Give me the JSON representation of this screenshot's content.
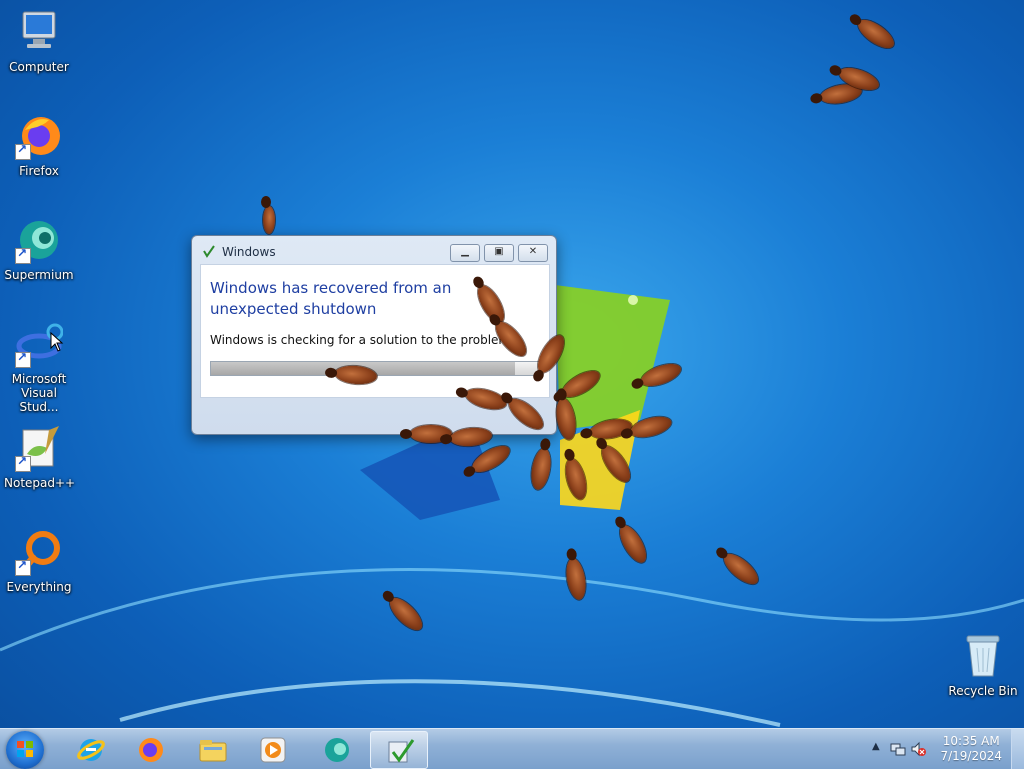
{
  "desktop": {
    "icons": [
      {
        "label": "Computer",
        "icon": "computer-icon"
      },
      {
        "label": "Firefox",
        "icon": "firefox-icon"
      },
      {
        "label": "Supermium",
        "icon": "supermium-icon"
      },
      {
        "label": "Microsoft Visual Stud...",
        "icon": "visual-studio-icon"
      },
      {
        "label": "Notepad++",
        "icon": "notepadpp-icon"
      },
      {
        "label": "Everything",
        "icon": "everything-icon"
      }
    ],
    "recycle_bin": {
      "label": "Recycle Bin",
      "icon": "recycle-bin-icon"
    }
  },
  "dialog": {
    "title": "Windows",
    "heading": "Windows has recovered from an unexpected shutdown",
    "status": "Windows is checking for a solution to the problem...",
    "progress": 0.92
  },
  "taskbar": {
    "items": [
      "internet-explorer-icon",
      "firefox-icon",
      "file-explorer-icon",
      "media-player-icon",
      "supermium-icon",
      "windows-problem-reporting-icon"
    ],
    "clock": {
      "time": "10:35 AM",
      "date": "7/19/2024"
    }
  },
  "colors": {
    "desktop_blue": "#1b7fd6",
    "dialog_heading": "#1f3fa2"
  }
}
